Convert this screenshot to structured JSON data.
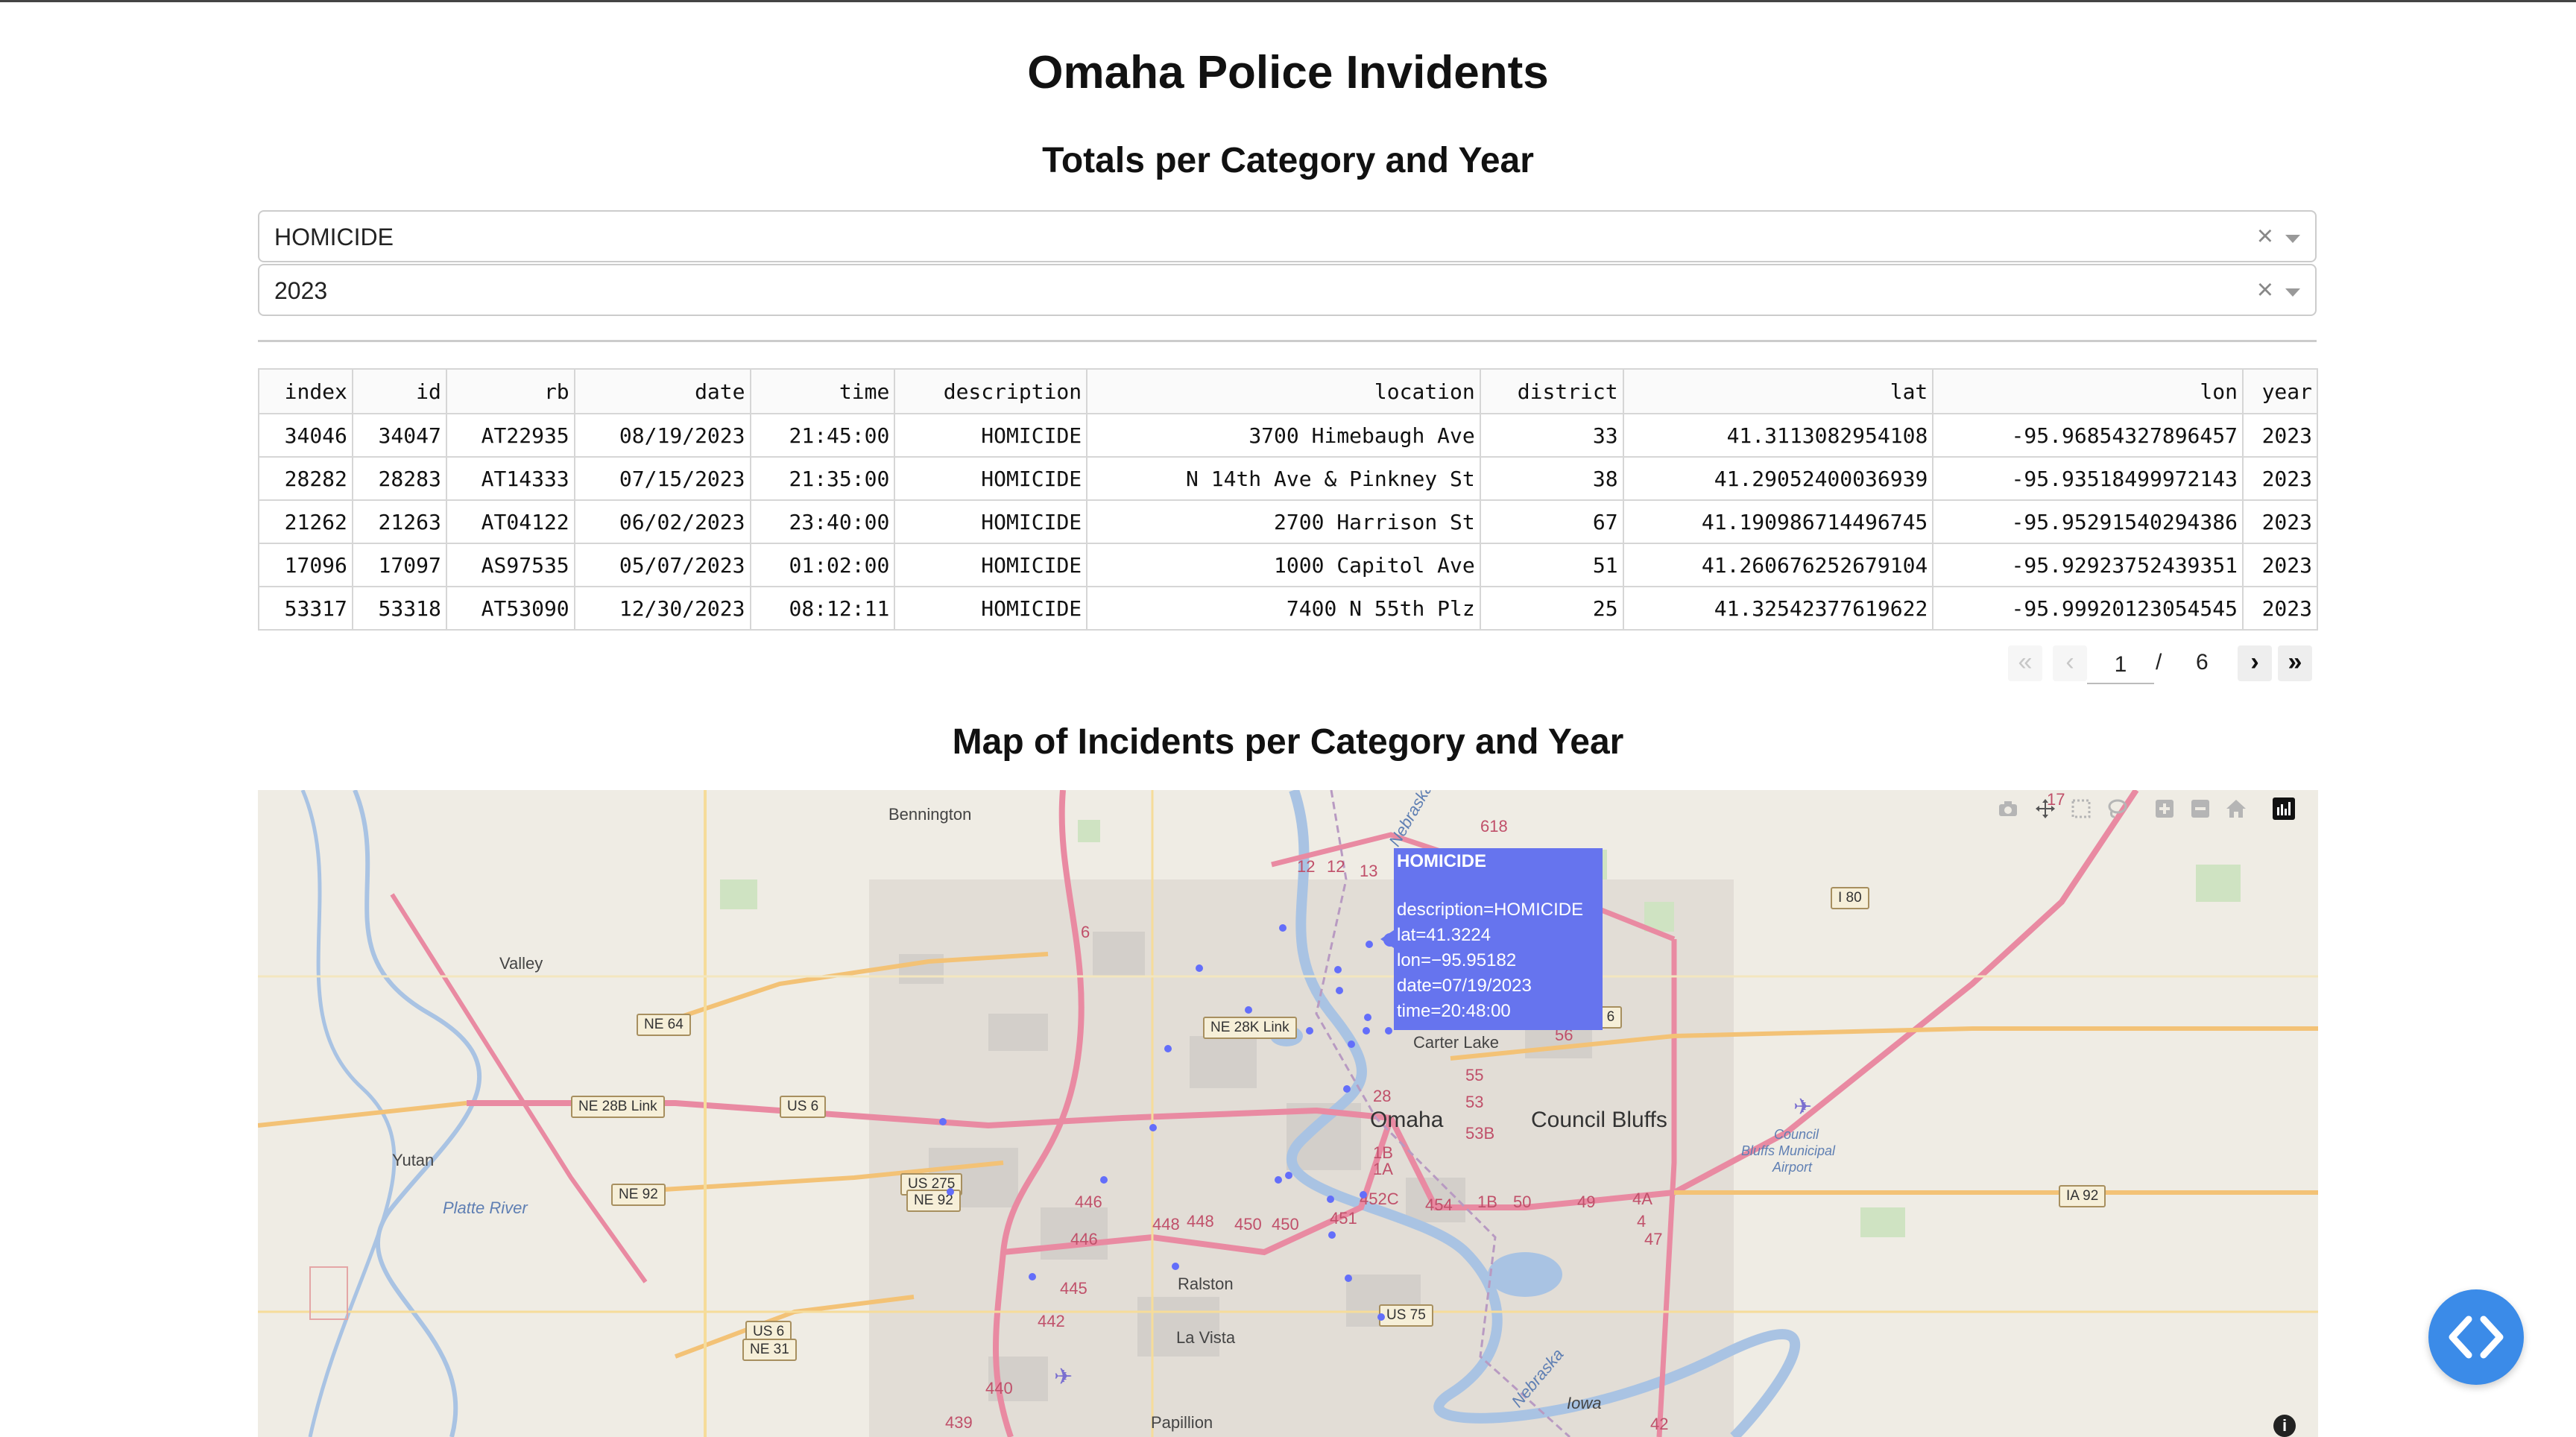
{
  "page": {
    "title": "Omaha Police Invidents",
    "table_heading": "Totals per Category and Year",
    "map_heading": "Map of Incidents per Category and Year"
  },
  "filters": {
    "category": {
      "value": "HOMICIDE",
      "clear": "×"
    },
    "year": {
      "value": "2023",
      "clear": "×"
    }
  },
  "table": {
    "columns": [
      "index",
      "id",
      "rb",
      "date",
      "time",
      "description",
      "location",
      "district",
      "lat",
      "lon",
      "year"
    ],
    "rows": [
      [
        "34046",
        "34047",
        "AT22935",
        "08/19/2023",
        "21:45:00",
        "HOMICIDE",
        "3700 Himebaugh Ave",
        "33",
        "41.3113082954108",
        "-95.96854327896457",
        "2023"
      ],
      [
        "28282",
        "28283",
        "AT14333",
        "07/15/2023",
        "21:35:00",
        "HOMICIDE",
        "N 14th Ave & Pinkney St",
        "38",
        "41.29052400036939",
        "-95.93518499972143",
        "2023"
      ],
      [
        "21262",
        "21263",
        "AT04122",
        "06/02/2023",
        "23:40:00",
        "HOMICIDE",
        "2700 Harrison St",
        "67",
        "41.190986714496745",
        "-95.95291540294386",
        "2023"
      ],
      [
        "17096",
        "17097",
        "AS97535",
        "05/07/2023",
        "01:02:00",
        "HOMICIDE",
        "1000 Capitol Ave",
        "51",
        "41.260676252679104",
        "-95.92923752439351",
        "2023"
      ],
      [
        "53317",
        "53318",
        "AT53090",
        "12/30/2023",
        "08:12:11",
        "HOMICIDE",
        "7400 N 55th Plz",
        "25",
        "41.32542377619622",
        "-95.99920123054545",
        "2023"
      ]
    ]
  },
  "pagination": {
    "first": "«",
    "prev": "‹",
    "current": "1",
    "separator": "/",
    "total": "6",
    "next": "›",
    "last": "»"
  },
  "map": {
    "place_labels": {
      "bennington": "Bennington",
      "valley": "Valley",
      "yutan": "Yutan",
      "omaha": "Omaha",
      "council_bluffs": "Council Bluffs",
      "carter_lake": "Carter Lake",
      "ralston": "Ralston",
      "la_vista": "La Vista",
      "papillion": "Papillion",
      "platte_river": "Platte River",
      "nebraska_top": "Nebraska",
      "nebraska_bottom": "Nebraska",
      "iowa": "Iowa",
      "airport_1": "Council",
      "airport_2": "Bluffs Municipal",
      "airport_3": "Airport"
    },
    "shields": {
      "ne64": "NE 64",
      "ne28b_east": "NE 28K Link",
      "ne28b_west": "NE 28B Link",
      "us6_west": "US 6",
      "us6_east": "US 6",
      "us275": "US 275",
      "ne92_sub": "NE 92",
      "ne92": "NE 92",
      "us6_sw": "US 6",
      "ne31": "NE 31",
      "i80": "I 80",
      "ia92": "IA 92",
      "us75": "US 75"
    },
    "road_numbers": [
      "618",
      "12",
      "12",
      "13",
      "6",
      "28",
      "1B",
      "1A",
      "452C",
      "451",
      "454",
      "1B",
      "50",
      "49",
      "4A",
      "4",
      "47",
      "53B",
      "53",
      "55",
      "56",
      "446",
      "446",
      "448",
      "448",
      "450",
      "450",
      "445",
      "442",
      "440",
      "439",
      "42",
      "17"
    ],
    "tooltip": {
      "title": "HOMICIDE",
      "description": "description=HOMICIDE",
      "lat": "lat=41.3224",
      "lon": "lon=−95.95182",
      "date": "date=07/19/2023",
      "time": "time=20:48:00"
    },
    "marker_color": "#636efa",
    "info_glyph": "i"
  },
  "modebar": {
    "icons": [
      "camera-icon",
      "pan-icon",
      "box-select-icon",
      "lasso-icon",
      "zoom-in-icon",
      "zoom-out-icon",
      "home-icon",
      "plotly-logo-icon"
    ]
  },
  "fab": {
    "icon": "code-icon",
    "color": "#3b8be8"
  }
}
